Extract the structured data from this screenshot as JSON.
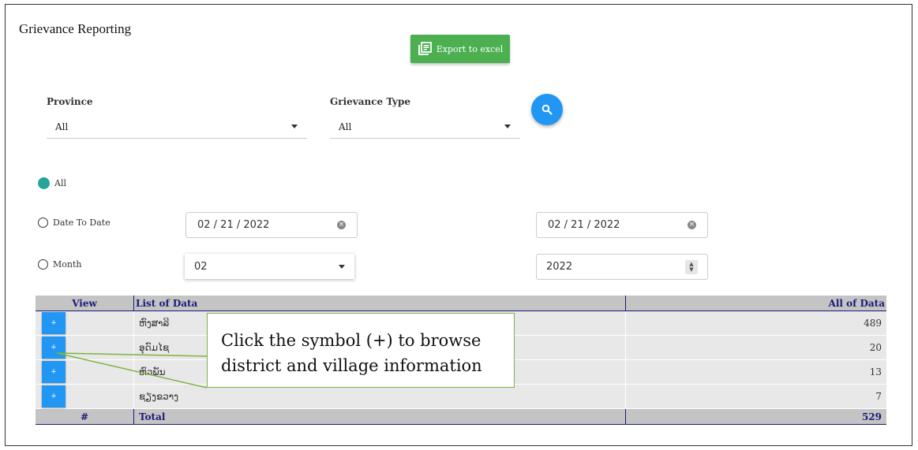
{
  "page": {
    "title": "Grievance Reporting"
  },
  "toolbar": {
    "export_label": "Export to excel"
  },
  "filters": {
    "province": {
      "label": "Province",
      "value": "All"
    },
    "grievance_type": {
      "label": "Grievance Type",
      "value": "All"
    }
  },
  "date_options": {
    "all_label": "All",
    "date_to_date_label": "Date To Date",
    "month_label": "Month",
    "date_from": "02 / 21 / 2022",
    "date_to": "02 / 21 / 2022",
    "month_value": "02",
    "year_value": "2022"
  },
  "table": {
    "headers": {
      "view": "View",
      "list": "List of Data",
      "all": "All of Data"
    },
    "rows": [
      {
        "name": "ຫົງສາລີ",
        "count": "489"
      },
      {
        "name": "ອຸດົມໄຊ",
        "count": "20"
      },
      {
        "name": "ຫົວພັນ",
        "count": "13"
      },
      {
        "name": "ຊຽງຂວາງ",
        "count": "7"
      }
    ],
    "plus_label": "+",
    "total": {
      "hash": "#",
      "label": "Total",
      "value": "529"
    }
  },
  "callout": {
    "text": "Click the symbol (+) to browse district and village information"
  },
  "colors": {
    "accent_blue": "#2196f3",
    "export_green": "#4caf50",
    "radio_teal": "#26a69a",
    "header_navy": "#1a1a7a"
  },
  "icons": {
    "export": "excel-list-icon",
    "search": "search-icon"
  }
}
